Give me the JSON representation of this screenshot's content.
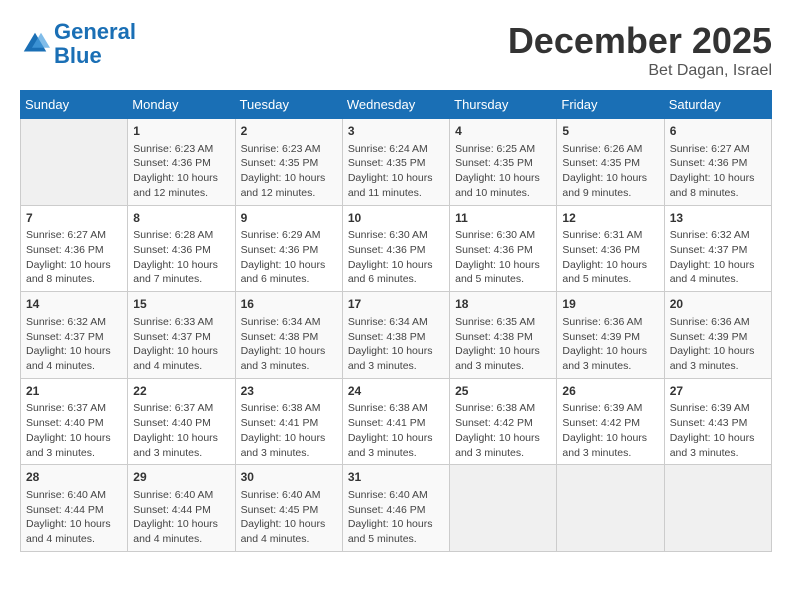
{
  "logo": {
    "line1": "General",
    "line2": "Blue"
  },
  "title": "December 2025",
  "location": "Bet Dagan, Israel",
  "days_header": [
    "Sunday",
    "Monday",
    "Tuesday",
    "Wednesday",
    "Thursday",
    "Friday",
    "Saturday"
  ],
  "weeks": [
    [
      {
        "day": "",
        "info": ""
      },
      {
        "day": "1",
        "info": "Sunrise: 6:23 AM\nSunset: 4:36 PM\nDaylight: 10 hours\nand 12 minutes."
      },
      {
        "day": "2",
        "info": "Sunrise: 6:23 AM\nSunset: 4:35 PM\nDaylight: 10 hours\nand 12 minutes."
      },
      {
        "day": "3",
        "info": "Sunrise: 6:24 AM\nSunset: 4:35 PM\nDaylight: 10 hours\nand 11 minutes."
      },
      {
        "day": "4",
        "info": "Sunrise: 6:25 AM\nSunset: 4:35 PM\nDaylight: 10 hours\nand 10 minutes."
      },
      {
        "day": "5",
        "info": "Sunrise: 6:26 AM\nSunset: 4:35 PM\nDaylight: 10 hours\nand 9 minutes."
      },
      {
        "day": "6",
        "info": "Sunrise: 6:27 AM\nSunset: 4:36 PM\nDaylight: 10 hours\nand 8 minutes."
      }
    ],
    [
      {
        "day": "7",
        "info": "Sunrise: 6:27 AM\nSunset: 4:36 PM\nDaylight: 10 hours\nand 8 minutes."
      },
      {
        "day": "8",
        "info": "Sunrise: 6:28 AM\nSunset: 4:36 PM\nDaylight: 10 hours\nand 7 minutes."
      },
      {
        "day": "9",
        "info": "Sunrise: 6:29 AM\nSunset: 4:36 PM\nDaylight: 10 hours\nand 6 minutes."
      },
      {
        "day": "10",
        "info": "Sunrise: 6:30 AM\nSunset: 4:36 PM\nDaylight: 10 hours\nand 6 minutes."
      },
      {
        "day": "11",
        "info": "Sunrise: 6:30 AM\nSunset: 4:36 PM\nDaylight: 10 hours\nand 5 minutes."
      },
      {
        "day": "12",
        "info": "Sunrise: 6:31 AM\nSunset: 4:36 PM\nDaylight: 10 hours\nand 5 minutes."
      },
      {
        "day": "13",
        "info": "Sunrise: 6:32 AM\nSunset: 4:37 PM\nDaylight: 10 hours\nand 4 minutes."
      }
    ],
    [
      {
        "day": "14",
        "info": "Sunrise: 6:32 AM\nSunset: 4:37 PM\nDaylight: 10 hours\nand 4 minutes."
      },
      {
        "day": "15",
        "info": "Sunrise: 6:33 AM\nSunset: 4:37 PM\nDaylight: 10 hours\nand 4 minutes."
      },
      {
        "day": "16",
        "info": "Sunrise: 6:34 AM\nSunset: 4:38 PM\nDaylight: 10 hours\nand 3 minutes."
      },
      {
        "day": "17",
        "info": "Sunrise: 6:34 AM\nSunset: 4:38 PM\nDaylight: 10 hours\nand 3 minutes."
      },
      {
        "day": "18",
        "info": "Sunrise: 6:35 AM\nSunset: 4:38 PM\nDaylight: 10 hours\nand 3 minutes."
      },
      {
        "day": "19",
        "info": "Sunrise: 6:36 AM\nSunset: 4:39 PM\nDaylight: 10 hours\nand 3 minutes."
      },
      {
        "day": "20",
        "info": "Sunrise: 6:36 AM\nSunset: 4:39 PM\nDaylight: 10 hours\nand 3 minutes."
      }
    ],
    [
      {
        "day": "21",
        "info": "Sunrise: 6:37 AM\nSunset: 4:40 PM\nDaylight: 10 hours\nand 3 minutes."
      },
      {
        "day": "22",
        "info": "Sunrise: 6:37 AM\nSunset: 4:40 PM\nDaylight: 10 hours\nand 3 minutes."
      },
      {
        "day": "23",
        "info": "Sunrise: 6:38 AM\nSunset: 4:41 PM\nDaylight: 10 hours\nand 3 minutes."
      },
      {
        "day": "24",
        "info": "Sunrise: 6:38 AM\nSunset: 4:41 PM\nDaylight: 10 hours\nand 3 minutes."
      },
      {
        "day": "25",
        "info": "Sunrise: 6:38 AM\nSunset: 4:42 PM\nDaylight: 10 hours\nand 3 minutes."
      },
      {
        "day": "26",
        "info": "Sunrise: 6:39 AM\nSunset: 4:42 PM\nDaylight: 10 hours\nand 3 minutes."
      },
      {
        "day": "27",
        "info": "Sunrise: 6:39 AM\nSunset: 4:43 PM\nDaylight: 10 hours\nand 3 minutes."
      }
    ],
    [
      {
        "day": "28",
        "info": "Sunrise: 6:40 AM\nSunset: 4:44 PM\nDaylight: 10 hours\nand 4 minutes."
      },
      {
        "day": "29",
        "info": "Sunrise: 6:40 AM\nSunset: 4:44 PM\nDaylight: 10 hours\nand 4 minutes."
      },
      {
        "day": "30",
        "info": "Sunrise: 6:40 AM\nSunset: 4:45 PM\nDaylight: 10 hours\nand 4 minutes."
      },
      {
        "day": "31",
        "info": "Sunrise: 6:40 AM\nSunset: 4:46 PM\nDaylight: 10 hours\nand 5 minutes."
      },
      {
        "day": "",
        "info": ""
      },
      {
        "day": "",
        "info": ""
      },
      {
        "day": "",
        "info": ""
      }
    ]
  ]
}
